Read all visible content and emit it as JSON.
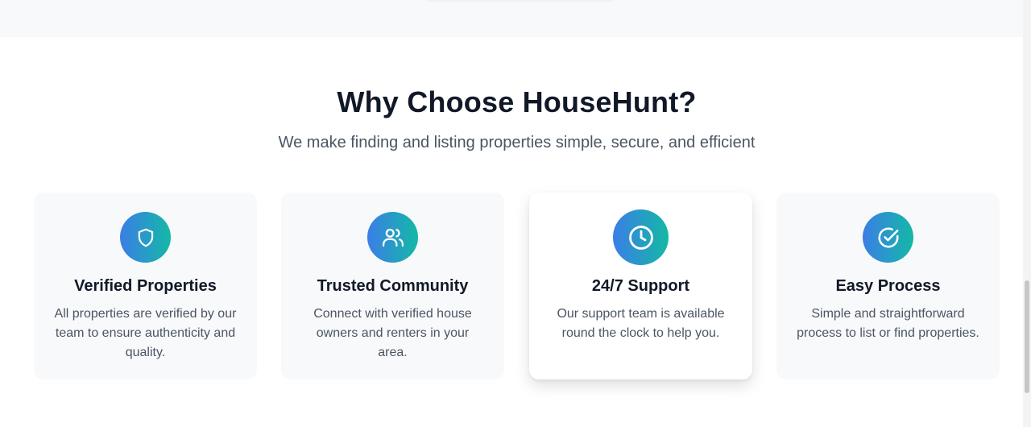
{
  "section": {
    "title": "Why Choose HouseHunt?",
    "subtitle": "We make finding and listing properties simple, secure, and efficient"
  },
  "features": [
    {
      "icon": "shield-icon",
      "title": "Verified Properties",
      "description": "All properties are verified by our team to ensure authenticity and quality."
    },
    {
      "icon": "users-icon",
      "title": "Trusted Community",
      "description": "Connect with verified house owners and renters in your area."
    },
    {
      "icon": "clock-icon",
      "title": "24/7 Support",
      "description": "Our support team is available round the clock to help you."
    },
    {
      "icon": "check-circle-icon",
      "title": "Easy Process",
      "description": "Simple and straightforward process to list or find properties."
    }
  ],
  "colors": {
    "gradient_start": "#3b7ee6",
    "gradient_end": "#14b8a6",
    "heading": "#111827",
    "body_text": "#4b5563",
    "card_background": "#f8f9fb"
  }
}
